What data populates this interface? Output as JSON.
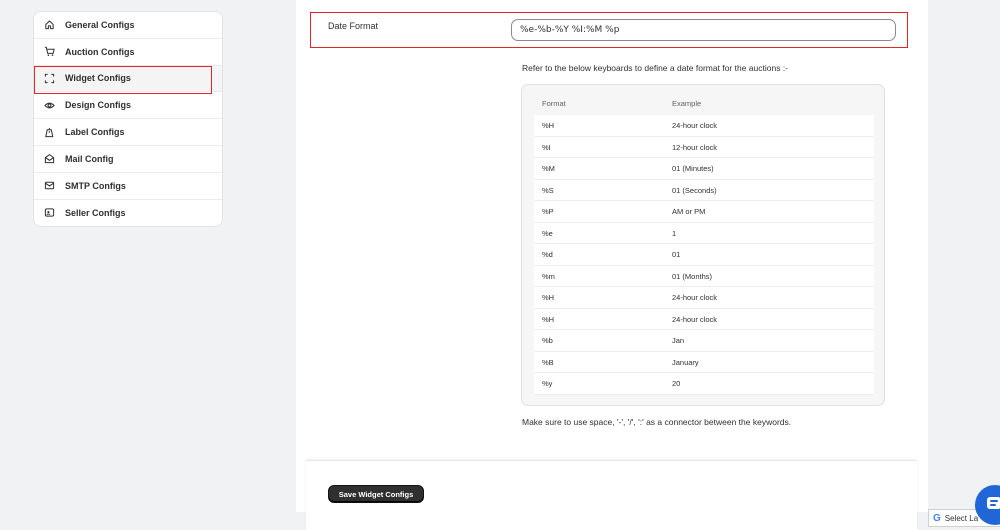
{
  "sidebar": {
    "items": [
      {
        "label": "General Configs",
        "icon": "home-icon"
      },
      {
        "label": "Auction Configs",
        "icon": "auction-icon"
      },
      {
        "label": "Widget Configs",
        "icon": "widget-icon",
        "active": true
      },
      {
        "label": "Design Configs",
        "icon": "eye-icon"
      },
      {
        "label": "Label Configs",
        "icon": "label-icon"
      },
      {
        "label": "Mail Config",
        "icon": "mail-icon"
      },
      {
        "label": "SMTP Configs",
        "icon": "envelope-icon"
      },
      {
        "label": "Seller Configs",
        "icon": "seller-icon"
      }
    ]
  },
  "date_format": {
    "label": "Date Format",
    "value": "%e-%b-%Y %I:%M %p"
  },
  "help_text": "Refer to the below keyboards to define a date format for the auctions :-",
  "reference": {
    "headers": [
      "Format",
      "Example"
    ],
    "rows": [
      [
        "%H",
        "24-hour clock"
      ],
      [
        "%I",
        "12-hour clock"
      ],
      [
        "%M",
        "01 (Minutes)"
      ],
      [
        "%S",
        "01 (Seconds)"
      ],
      [
        "%P",
        "AM or PM"
      ],
      [
        "%e",
        "1"
      ],
      [
        "%d",
        "01"
      ],
      [
        "%m",
        "01 (Months)"
      ],
      [
        "%H",
        "24-hour clock"
      ],
      [
        "%H",
        "24-hour clock"
      ],
      [
        "%b",
        "Jan"
      ],
      [
        "%B",
        "January"
      ],
      [
        "%y",
        "20"
      ]
    ]
  },
  "note": "Make sure to use space, '-', '/', ':' as a connector between the keywords.",
  "save_label": "Save Widget Configs",
  "translate": {
    "logo": "G",
    "label": "Select La"
  },
  "colors": {
    "highlight": "#e0262a",
    "button": "#303030",
    "chat": "#2166d6"
  }
}
